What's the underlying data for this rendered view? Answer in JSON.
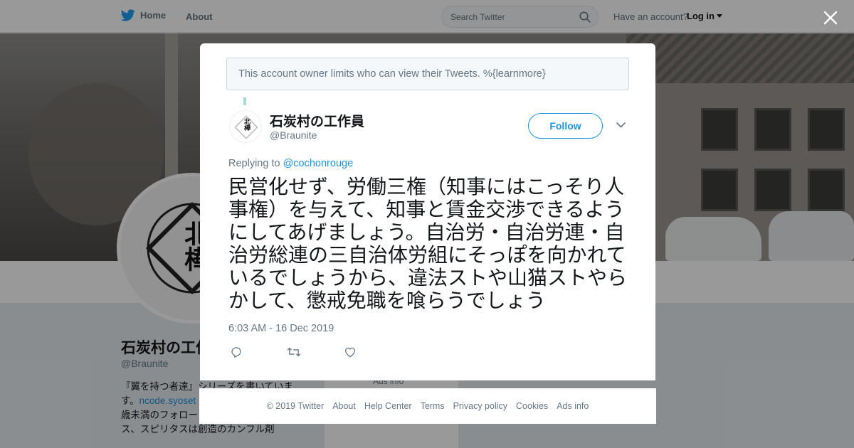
{
  "topbar": {
    "home_label": "Home",
    "about_label": "About",
    "search_placeholder": "Search Twitter",
    "have_account": "Have an account?",
    "login_label": "Log in"
  },
  "background_profile": {
    "name": "石炭村の工作員",
    "handle": "@Braunite",
    "bio_line1": "『翼を持つ者達』シリーズを書いていま",
    "bio_line2_prefix": "す。",
    "bio_link": "ncode.syoset",
    "bio_line3": "歳未満のフォロー",
    "bio_line4": "ス、スピリタスは創造のカンフル剤",
    "ads_label": "Ads info",
    "avatar_text": "北樺"
  },
  "modal": {
    "notice": "This account owner limits who can view their Tweets. %{learnmore}",
    "author_name": "石炭村の工作員",
    "author_handle": "@Braunite",
    "avatar_text": "北樺",
    "follow_label": "Follow",
    "replying_prefix": "Replying to",
    "replying_handle": "@cochonrouge",
    "tweet_text": "民営化せず、労働三権（知事にはこっそり人事権）を与えて、知事と賃金交渉できるようにしてあげましょう。自治労・自治労連・自治労総連の三自治体労組にそっぽを向かれているでしょうから、違法ストや山猫ストやらかして、懲戒免職を喰らうでしょう",
    "timestamp": "6:03 AM - 16 Dec 2019",
    "icons": [
      "reply-icon",
      "retweet-icon",
      "like-icon"
    ]
  },
  "footer": {
    "copyright": "© 2019 Twitter",
    "about": "About",
    "help_center": "Help Center",
    "terms": "Terms",
    "privacy": "Privacy policy",
    "cookies": "Cookies",
    "ads_info": "Ads info"
  },
  "colors": {
    "accent": "#1b95e0",
    "muted": "#657786",
    "thread_line": "#a4d9de"
  }
}
